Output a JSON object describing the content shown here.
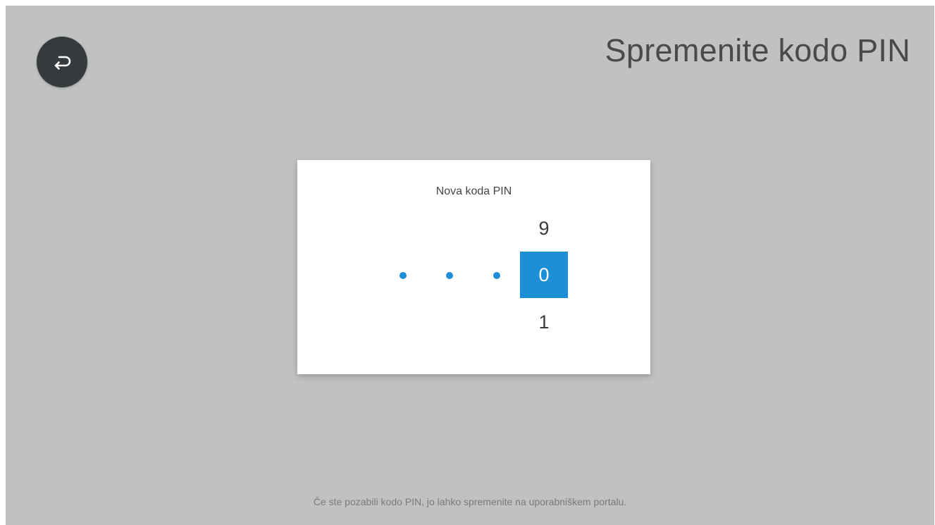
{
  "header": {
    "title": "Spremenite kodo PIN",
    "back_icon": "return-arrow-icon"
  },
  "pin_entry": {
    "label": "Nova koda PIN",
    "entered_count": 3,
    "picker": {
      "previous": "9",
      "current": "0",
      "next": "1"
    }
  },
  "footer": {
    "hint": "Če ste pozabili kodo PIN, jo lahko spremenite na uporabniškem portalu."
  },
  "colors": {
    "background": "#c1c1c1",
    "accent": "#1e8fd6",
    "back_button": "#353a3d"
  }
}
